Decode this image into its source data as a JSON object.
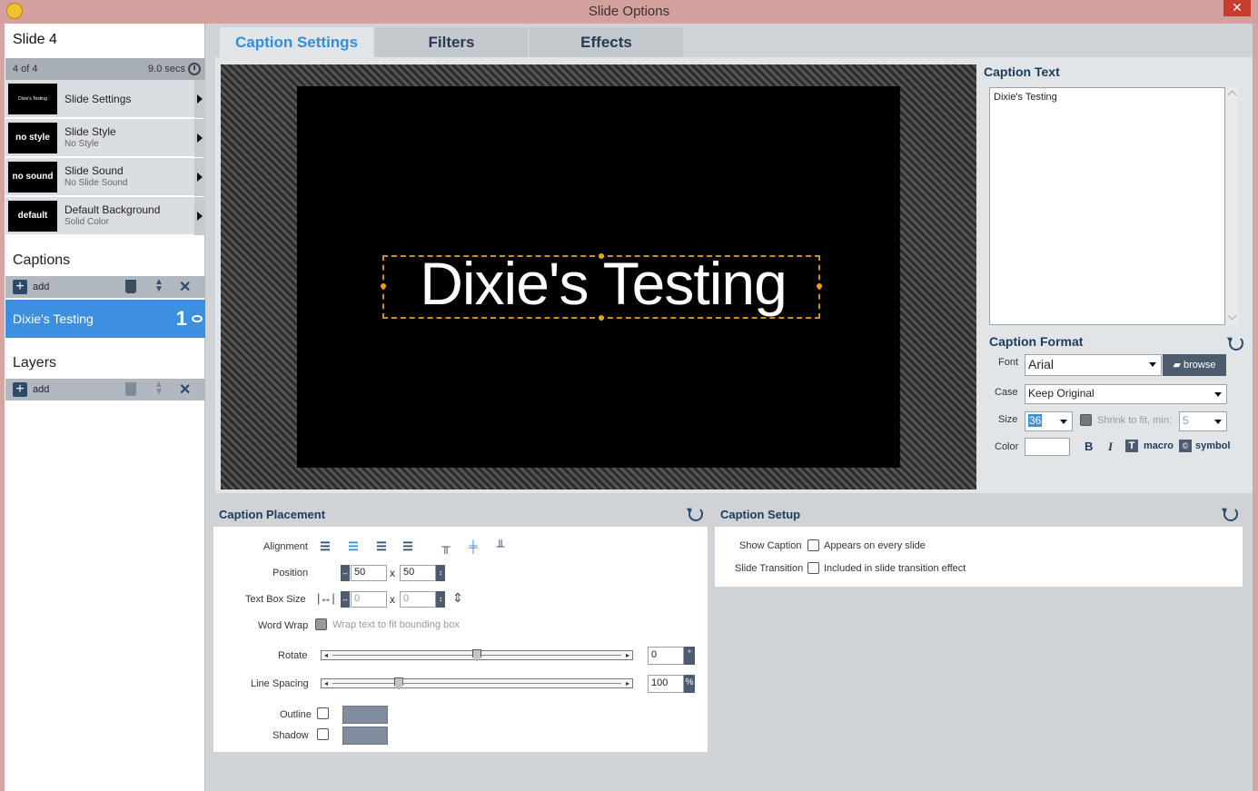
{
  "window": {
    "title": "Slide Options",
    "close_label": "✕"
  },
  "slide": {
    "title": "Slide 4",
    "index_text": "4 of 4",
    "duration": "9.0 secs"
  },
  "slide_items": [
    {
      "main": "Slide Settings",
      "sub": "",
      "thumb": "Dixie's Testing"
    },
    {
      "main": "Slide Style",
      "sub": "No Style",
      "thumb": "no style"
    },
    {
      "main": "Slide Sound",
      "sub": "No Slide Sound",
      "thumb": "no sound"
    },
    {
      "main": "Default Background",
      "sub": "Solid Color",
      "thumb": "default"
    }
  ],
  "captions": {
    "heading": "Captions",
    "add_label": "add",
    "items": [
      {
        "name": "Dixie's Testing",
        "number": "1"
      }
    ]
  },
  "layers": {
    "heading": "Layers",
    "add_label": "add"
  },
  "tabs": [
    "Caption Settings",
    "Filters",
    "Effects"
  ],
  "preview": {
    "caption": "Dixie's Testing"
  },
  "caption_text": {
    "heading": "Caption Text",
    "value": "Dixie's Testing"
  },
  "caption_format": {
    "heading": "Caption Format",
    "font_label": "Font",
    "font_value": "Arial",
    "browse_label": "browse",
    "case_label": "Case",
    "case_value": "Keep Original",
    "size_label": "Size",
    "size_value": "36",
    "shrink_label": "Shrink to fit, min:",
    "shrink_value": "5",
    "color_label": "Color",
    "bold": "B",
    "italic": "I",
    "text_icon": "T",
    "macro_label": "macro",
    "symbol_label": "symbol"
  },
  "placement": {
    "heading": "Caption Placement",
    "alignment_label": "Alignment",
    "position_label": "Position",
    "pos_x": "50",
    "pos_y": "50",
    "x_sep": "x",
    "textbox_label": "Text Box Size",
    "box_w": "0",
    "box_h": "0",
    "wordwrap_label": "Word Wrap",
    "wordwrap_text": "Wrap text to fit bounding box",
    "rotate_label": "Rotate",
    "rotate_value": "0",
    "rotate_unit": "°",
    "rotate_fraction": 0.5,
    "spacing_label": "Line Spacing",
    "spacing_value": "100",
    "spacing_unit": "%",
    "spacing_fraction": 0.22,
    "outline_label": "Outline",
    "shadow_label": "Shadow",
    "swatch_color": "#7f8d9e"
  },
  "setup": {
    "heading": "Caption Setup",
    "show_label": "Show Caption",
    "show_text": "Appears on every slide",
    "transition_label": "Slide Transition",
    "transition_text": "Included in slide transition effect"
  },
  "colors": {
    "accent": "#2f8ee0",
    "selected_row": "#3d8fe0",
    "titlebar": "#d4a09e"
  }
}
